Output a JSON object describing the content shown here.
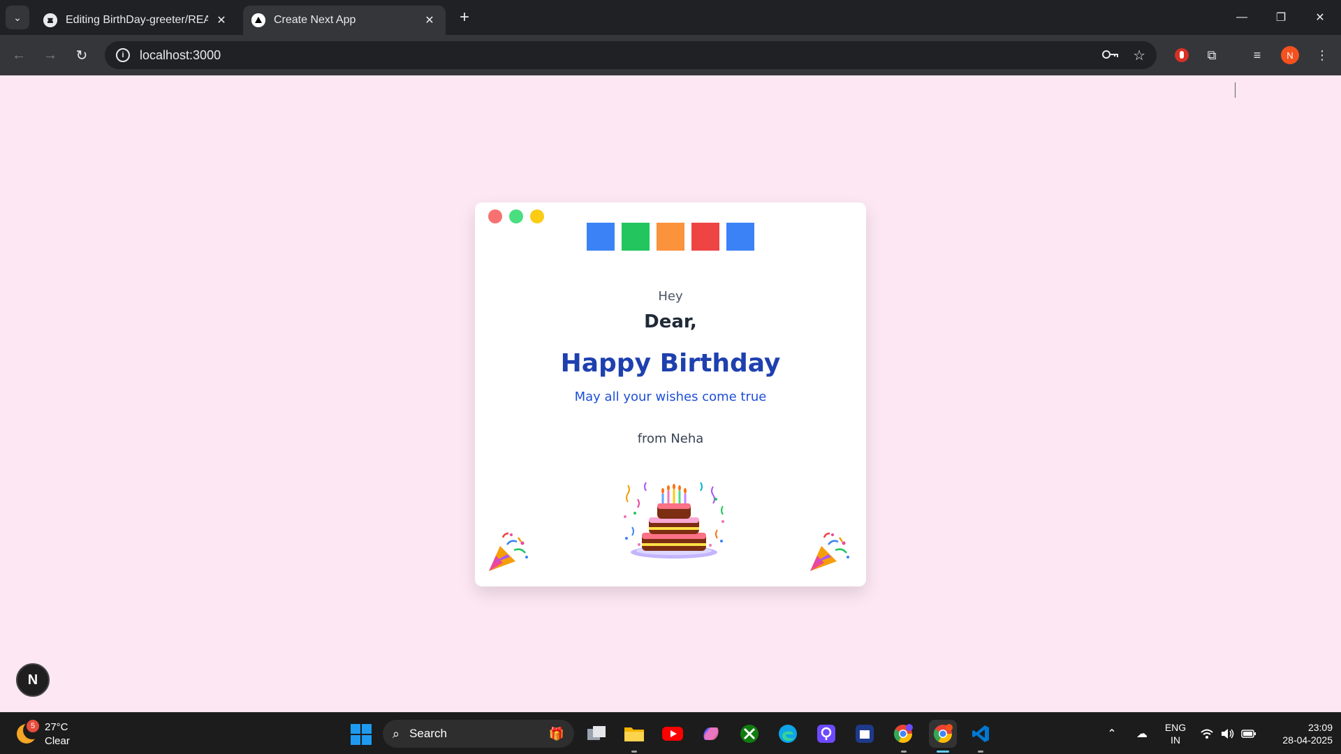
{
  "browser": {
    "tabs": [
      {
        "title": "Editing BirthDay-greeter/READM",
        "icon": "github-icon",
        "active": false
      },
      {
        "title": "Create Next App",
        "icon": "nextjs-triangle-icon",
        "active": true
      }
    ],
    "url": "localhost:3000",
    "profile_initial": "N"
  },
  "card": {
    "window_dots": [
      "#f87171",
      "#4ade80",
      "#facc15"
    ],
    "squares": [
      "#3b82f6",
      "#22c55e",
      "#fb923c",
      "#ef4444",
      "#3b82f6"
    ],
    "greeting": "Hey",
    "salutation": "Dear,",
    "headline": "Happy Birthday",
    "wish": "May all your wishes come true",
    "signature": "from Neha"
  },
  "dev_indicator": {
    "label": "N"
  },
  "taskbar": {
    "weather": {
      "temp": "27°C",
      "condition": "Clear",
      "badge": "5"
    },
    "search_label": "Search",
    "apps": [
      "task-view",
      "file-explorer",
      "youtube",
      "copilot",
      "xbox",
      "edge",
      "proton-pass",
      "teams",
      "chrome-profile",
      "chrome",
      "vscode"
    ],
    "language": {
      "line1": "ENG",
      "line2": "IN"
    },
    "time": "23:09",
    "date": "28-04-2025"
  }
}
